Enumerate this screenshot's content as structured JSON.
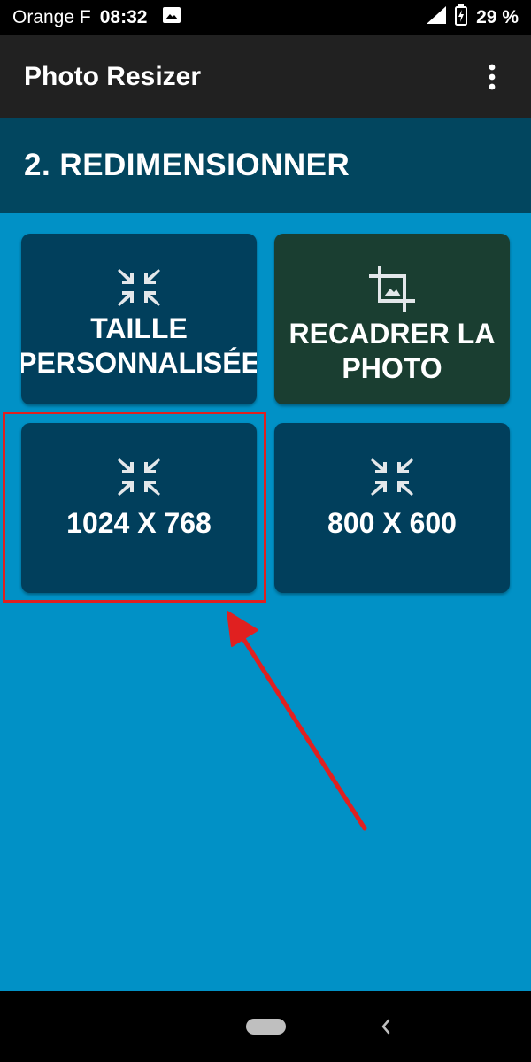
{
  "status_bar": {
    "carrier": "Orange F",
    "time": "08:32",
    "battery_percent": "29 %",
    "icons": [
      "image-notification-icon",
      "signal-icon",
      "battery-charging-icon"
    ]
  },
  "app_bar": {
    "title": "Photo Resizer",
    "menu_icon": "more-vert-icon"
  },
  "section": {
    "title": "2. REDIMENSIONNER"
  },
  "tiles": [
    {
      "label": "TAILLE PERSONNALISÉE",
      "icon": "compress-arrows-icon"
    },
    {
      "label": "RECADRER LA PHOTO",
      "icon": "crop-image-icon"
    },
    {
      "label": "1024 X 768",
      "icon": "compress-arrows-icon"
    },
    {
      "label": "800 X 600",
      "icon": "compress-arrows-icon"
    }
  ],
  "colors": {
    "background": "#0191c6",
    "section_header": "#02465f",
    "tile": "#013f5c",
    "tile_crop": "#1a3e31",
    "annotation": "#e02020"
  },
  "nav_bar": {
    "icons": [
      "home-pill-icon",
      "back-icon"
    ]
  }
}
